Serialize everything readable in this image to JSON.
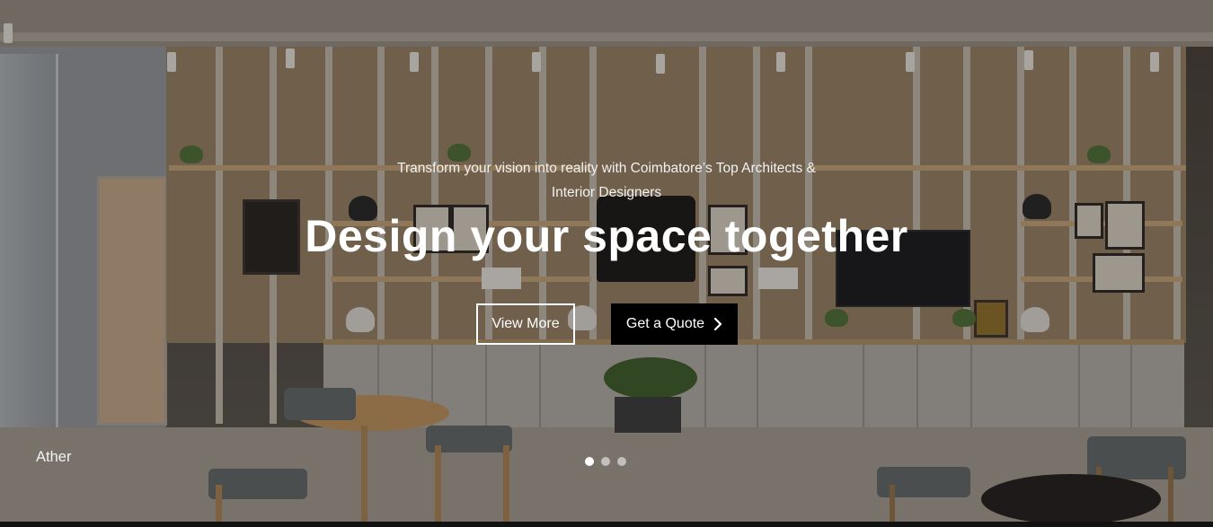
{
  "hero": {
    "tagline": "Transform your vision into reality with Coimbatore’s Top Architects & Interior Designers",
    "headline": "Design your space together",
    "buttons": {
      "view_more": "View More",
      "get_quote": "Get a Quote",
      "get_quote_icon": "chevron-right-icon"
    },
    "caption": "Ather",
    "carousel": {
      "slide_count": 3,
      "active_index": 0
    }
  },
  "colors": {
    "primary_button_bg": "#000000",
    "text": "#ffffff"
  }
}
